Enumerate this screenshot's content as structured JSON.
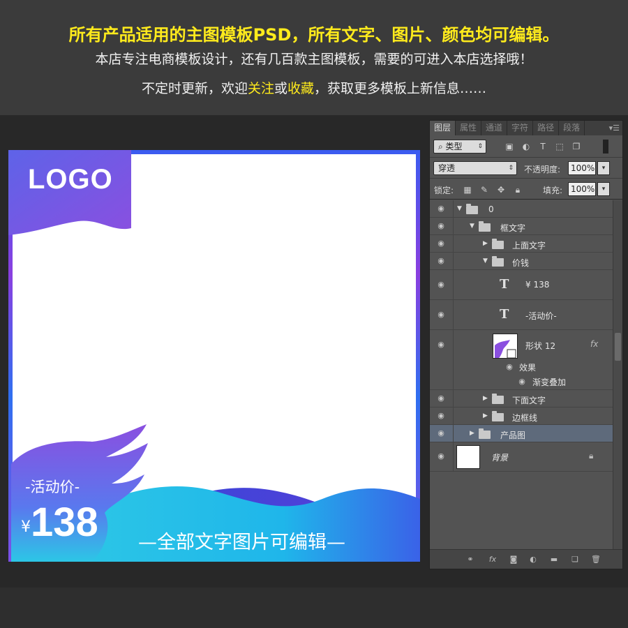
{
  "banner": {
    "line1": "所有产品适用的主图模板PSD，所有文字、图片、颜色均可编辑。",
    "line2": "本店专注电商模板设计，还有几百款主图模板，需要的可进入本店选择哦！",
    "line3_pre": "不定时更新，欢迎",
    "line3_follow": "关注",
    "line3_or": "或",
    "line3_fav": "收藏",
    "line3_post": "，获取更多模板上新信息……"
  },
  "canvas": {
    "logo": "LOGO",
    "price_label": "-活动价-",
    "currency": "¥",
    "price": "138",
    "slogan": "—全部文字图片可编辑—"
  },
  "panel": {
    "tabs": [
      "图层",
      "属性",
      "通道",
      "字符",
      "路径",
      "段落"
    ],
    "active_tab": "图层",
    "menu_icon": "panel-menu-icon",
    "filter_kind": "类型",
    "blend_mode": "穿透",
    "opacity_label": "不透明度:",
    "opacity_value": "100%",
    "lock_label": "锁定:",
    "fill_label": "填充:",
    "fill_value": "100%"
  },
  "layers": [
    {
      "name": "0",
      "type": "group",
      "expanded": true
    },
    {
      "name": "框文字",
      "type": "group",
      "expanded": true
    },
    {
      "name": "上面文字",
      "type": "group",
      "expanded": false
    },
    {
      "name": "价钱",
      "type": "group",
      "expanded": true
    },
    {
      "name": "¥ 138",
      "type": "text"
    },
    {
      "name": "-活动价-",
      "type": "text"
    },
    {
      "name": "形状 12",
      "type": "shape",
      "fx": "fx"
    },
    {
      "name": "效果",
      "type": "effects"
    },
    {
      "name": "渐变叠加",
      "type": "effect"
    },
    {
      "name": "下面文字",
      "type": "group",
      "expanded": false
    },
    {
      "name": "边框线",
      "type": "group",
      "expanded": false
    },
    {
      "name": "产品图",
      "type": "group",
      "expanded": false,
      "selected": true
    },
    {
      "name": "背景",
      "type": "background",
      "locked": true
    }
  ],
  "colors": {
    "banner_highlight": "#ffeb1c",
    "canvas_gradient_start": "#8a4fe0",
    "canvas_gradient_end": "#2cc6e6",
    "panel_bg": "#535353",
    "selected_layer": "#5e6a7b"
  }
}
